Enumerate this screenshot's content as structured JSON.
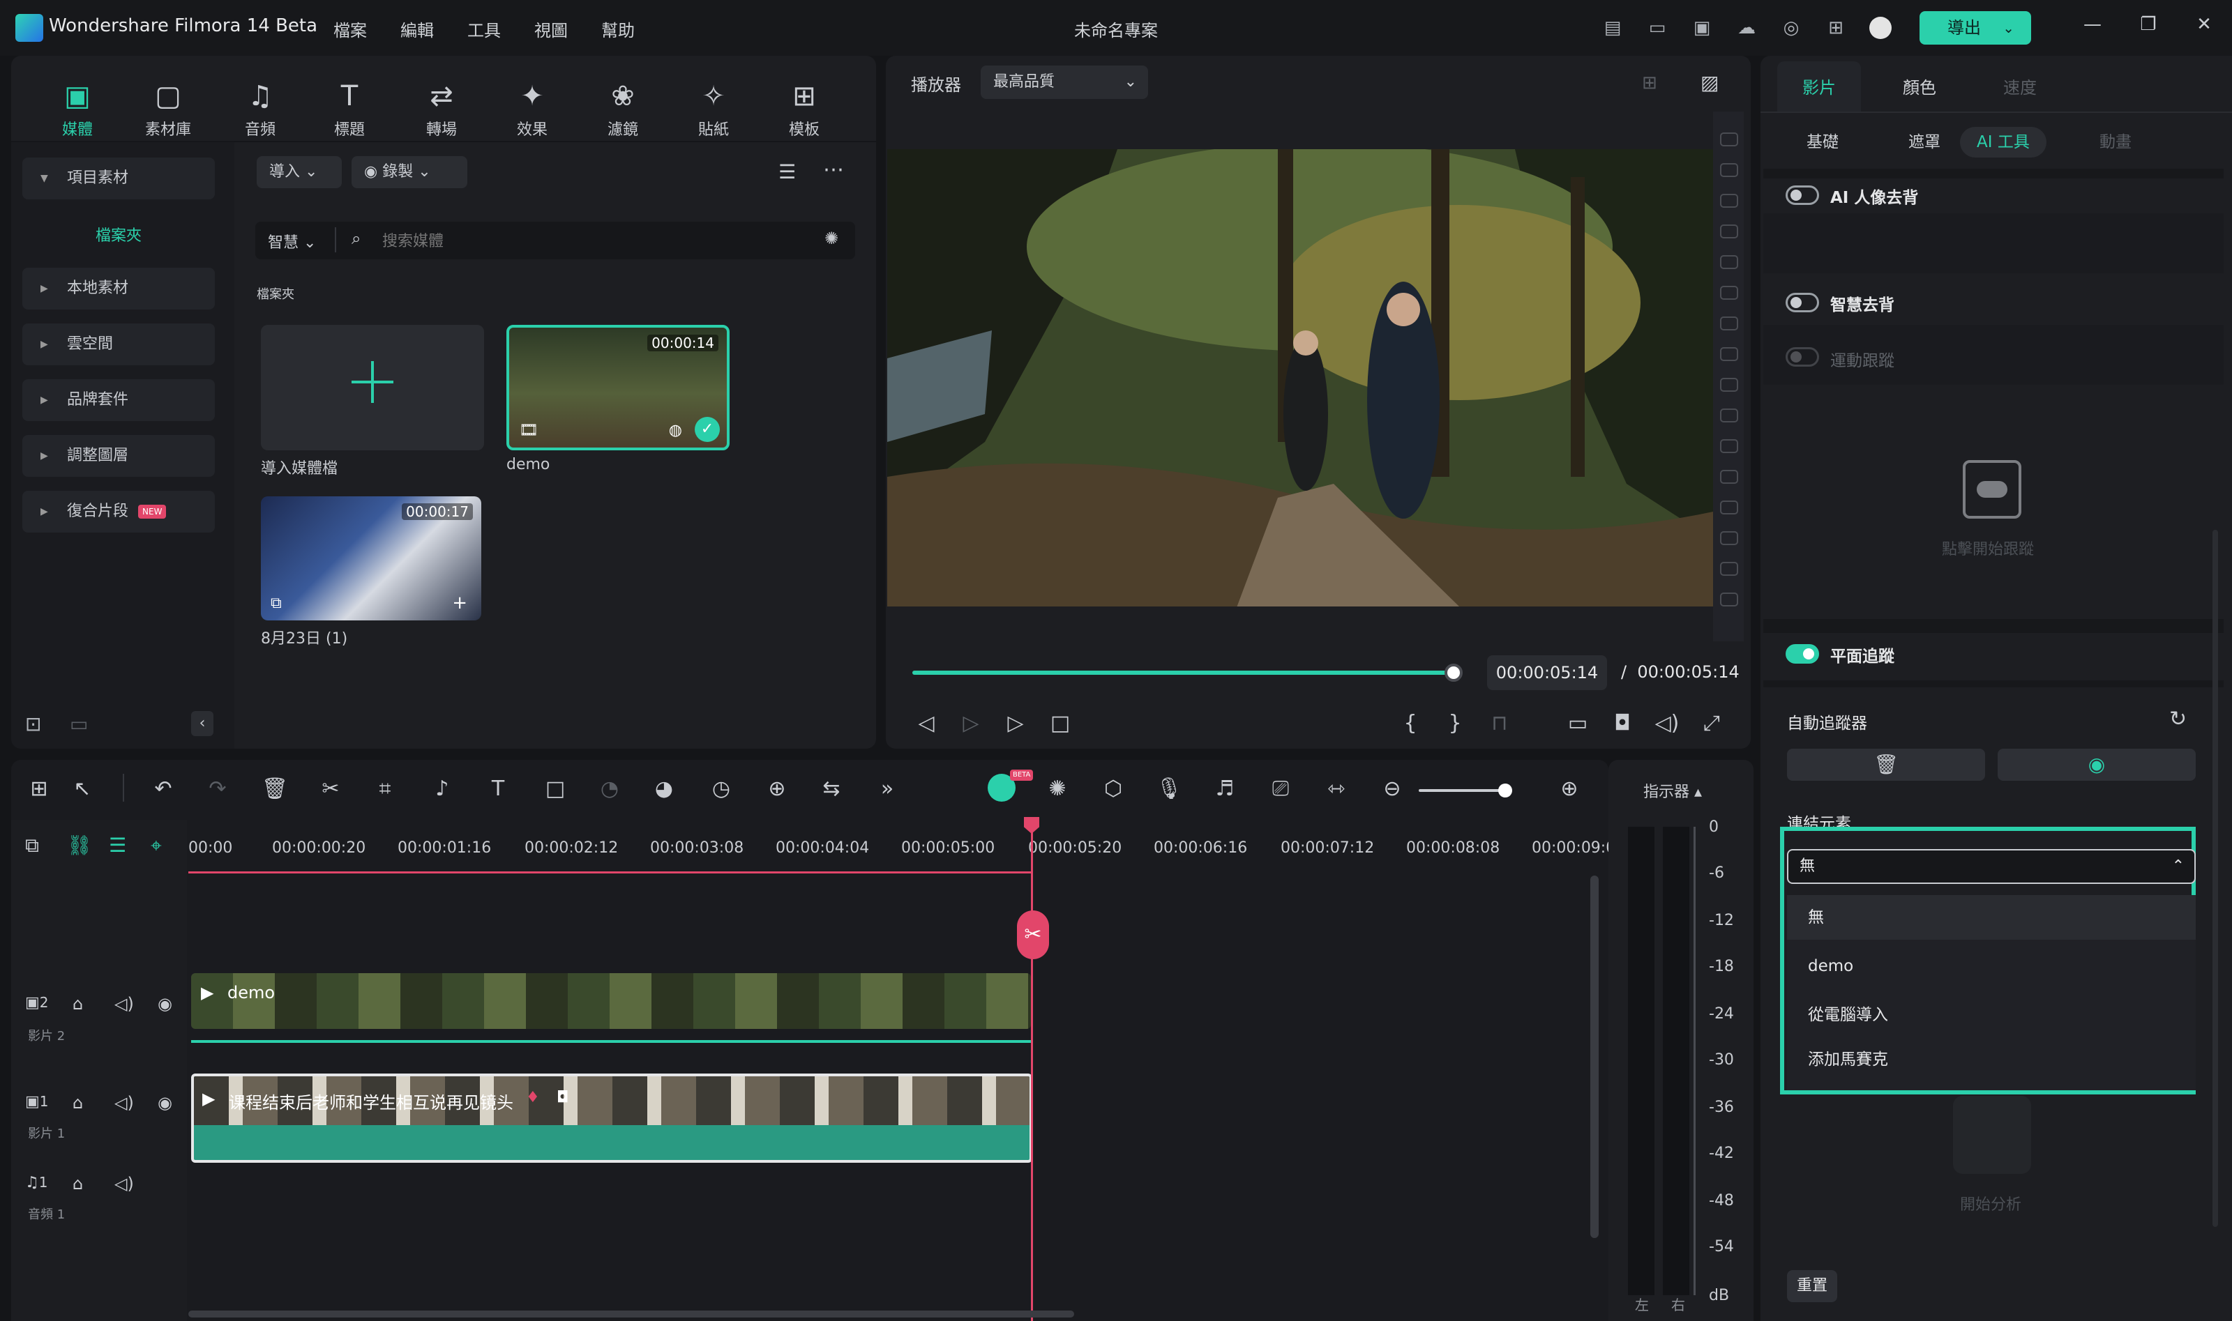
{
  "app": {
    "title": "Wondershare Filmora 14 Beta",
    "project": "未命名專案",
    "export_label": "導出"
  },
  "menu": [
    "檔案",
    "編輯",
    "工具",
    "視圖",
    "幫助"
  ],
  "media_tabs": [
    {
      "label": "媒體",
      "icon": "media-icon",
      "active": true
    },
    {
      "label": "素材庫",
      "icon": "stock-icon"
    },
    {
      "label": "音頻",
      "icon": "music-icon"
    },
    {
      "label": "標題",
      "icon": "title-icon"
    },
    {
      "label": "轉場",
      "icon": "transition-icon"
    },
    {
      "label": "效果",
      "icon": "effects-icon"
    },
    {
      "label": "濾鏡",
      "icon": "filters-icon"
    },
    {
      "label": "貼紙",
      "icon": "sticker-icon"
    },
    {
      "label": "模板",
      "icon": "template-icon"
    }
  ],
  "sidebar": {
    "project_media": "項目素材",
    "folder": "檔案夾",
    "items": [
      "本地素材",
      "雲空間",
      "品牌套件",
      "調整圖層",
      "復合片段"
    ],
    "new_badge": "NEW"
  },
  "media_toolbar": {
    "import": "導入",
    "record": "錄製",
    "smart": "智慧",
    "search_placeholder": "搜索媒體",
    "folder_label": "檔案夾"
  },
  "media_items": [
    {
      "label": "導入媒體檔",
      "type": "import"
    },
    {
      "label": "demo",
      "duration": "00:00:14",
      "selected": true
    },
    {
      "label": "8月23日 (1)",
      "duration": "00:00:17"
    }
  ],
  "player": {
    "label": "播放器",
    "quality": "最高品質",
    "current_time": "00:00:05:14",
    "separator": "/",
    "total_time": "00:00:05:14",
    "progress": 1.0
  },
  "right_panel": {
    "tabs": [
      {
        "label": "影片",
        "active": true
      },
      {
        "label": "顏色"
      },
      {
        "label": "速度",
        "dim": true
      }
    ],
    "subtabs": [
      {
        "label": "基礎"
      },
      {
        "label": "遮罩"
      },
      {
        "label": "AI 工具",
        "active": true
      },
      {
        "label": "動畫",
        "dim": true
      }
    ],
    "ai_portrait": "AI 人像去背",
    "smart_cutout": "智慧去背",
    "motion_tracking": "運動跟蹤",
    "click_start": "點擊開始跟蹤",
    "planar_tracking": "平面追蹤",
    "auto_tracker": "自動追蹤器",
    "link_element": "連結元素",
    "dropdown": {
      "selected": "無",
      "options": [
        "無",
        "demo",
        "從電腦導入",
        "添加馬賽克"
      ]
    },
    "start_analysis": "開始分析",
    "reset": "重置"
  },
  "timeline": {
    "ticks": [
      "00:00",
      "00:00:00:20",
      "00:00:01:16",
      "00:00:02:12",
      "00:00:03:08",
      "00:00:04:04",
      "00:00:05:00",
      "00:00:05:20",
      "00:00:06:16",
      "00:00:07:12",
      "00:00:08:08",
      "00:00:09:0"
    ],
    "indicator": "指示器",
    "tracks": [
      {
        "num": "2",
        "name": "影片 2",
        "clip": "demo"
      },
      {
        "num": "1",
        "name": "影片 1",
        "clip": "课程结束后老师和学生相互说再见镜头"
      },
      {
        "num": "1",
        "name": "音頻 1"
      }
    ],
    "ai_badge": "BETA"
  },
  "meter": {
    "levels": [
      "0",
      "-6",
      "-12",
      "-18",
      "-24",
      "-30",
      "-36",
      "-42",
      "-48",
      "-54",
      "dB"
    ],
    "left": "左",
    "right": "右"
  },
  "colors": {
    "accent": "#2bd0ab",
    "playhead": "#e2466a"
  }
}
